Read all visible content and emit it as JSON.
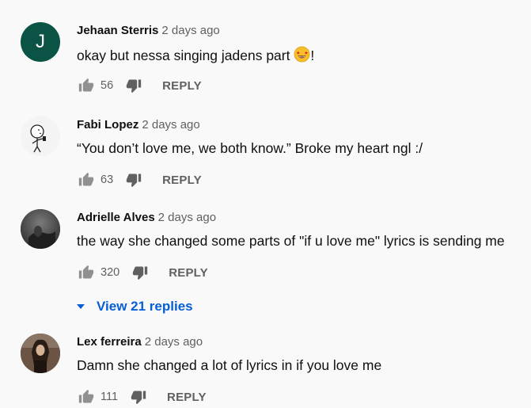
{
  "comments": [
    {
      "author": "Jehaan Sterris",
      "time": "2 days ago",
      "text": "okay but nessa singing jadens part ",
      "text_suffix": "!",
      "emoji": "star-struck-emoji",
      "avatar_letter": "J",
      "avatar_color": "#0b5345",
      "likes": "56",
      "reply_label": "REPLY"
    },
    {
      "author": "Fabi Lopez",
      "time": "2 days ago",
      "text": "“You don’t love me, we both know.” Broke my heart ngl :/",
      "likes": "63",
      "reply_label": "REPLY"
    },
    {
      "author": "Adrielle Alves",
      "time": "2 days ago",
      "text": "the way she changed  some parts of \"if u love me\" lyrics is sending me",
      "likes": "320",
      "reply_label": "REPLY",
      "view_replies": "View 21 replies"
    },
    {
      "author": "Lex ferreira",
      "time": "2 days ago",
      "text": "Damn she changed a lot of lyrics in if you love me",
      "likes": "111",
      "reply_label": "REPLY"
    }
  ],
  "icons": {
    "like": "thumb-up-icon",
    "dislike": "thumb-down-icon",
    "expand": "chevron-down-icon"
  },
  "colors": {
    "link": "#065fd4",
    "secondary_text": "#606060",
    "background": "#f9f9f9"
  }
}
